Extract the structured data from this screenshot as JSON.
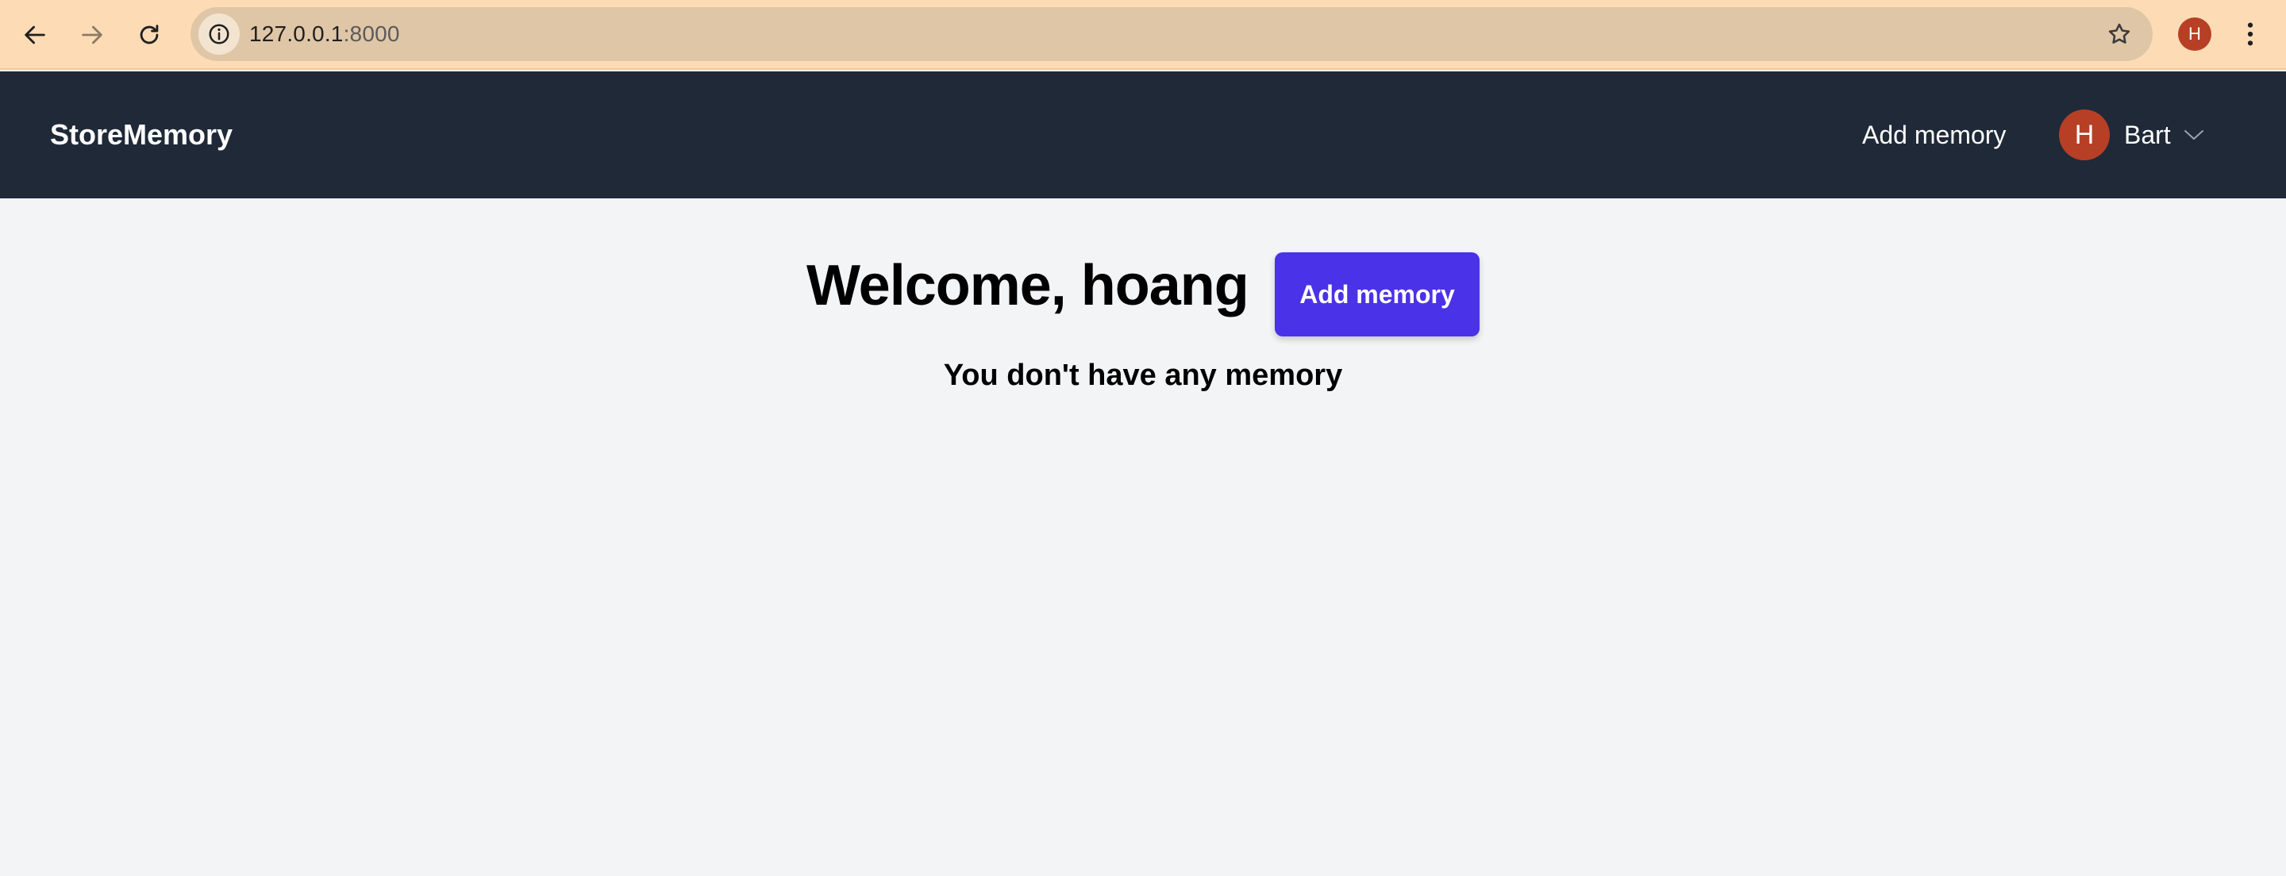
{
  "browser": {
    "url_host": "127.0.0.1",
    "url_port": ":8000",
    "profile_initial": "H",
    "icons": {
      "back": "arrow-left-icon",
      "forward": "arrow-right-icon",
      "reload": "reload-icon",
      "site_info": "info-icon",
      "bookmark": "star-icon",
      "menu": "kebab-menu-icon"
    },
    "colors": {
      "toolbar": "#fddcb5",
      "omnibox": "#dfc6a7",
      "profile": "#b73f25"
    }
  },
  "navbar": {
    "brand": "StoreMemory",
    "add_memory_link": "Add memory",
    "user": {
      "avatar_initial": "H",
      "name": "Bart",
      "chevron_icon": "chevron-down-icon"
    },
    "colors": {
      "background": "#1f2937",
      "avatar": "#b73f25"
    }
  },
  "main": {
    "welcome": "Welcome, hoang",
    "add_memory_button": "Add memory",
    "empty_message": "You don't have any memory",
    "colors": {
      "background": "#f3f4f6",
      "primary_button": "#4a32e8"
    }
  }
}
